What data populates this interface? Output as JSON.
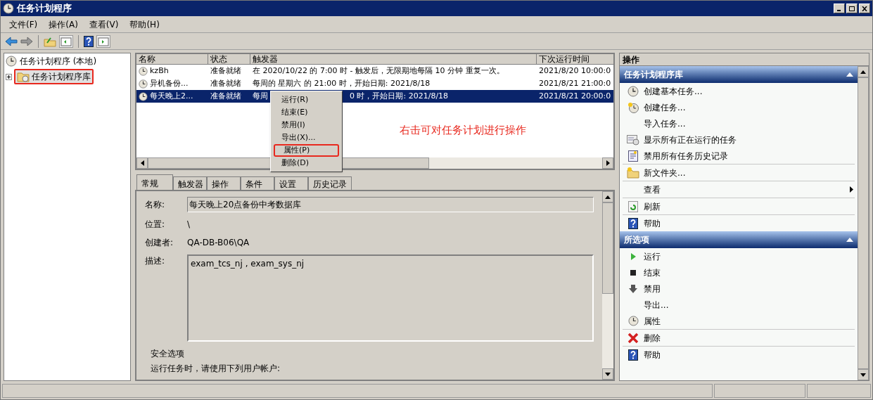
{
  "window": {
    "title": "任务计划程序"
  },
  "menu_bar": [
    "文件(F)",
    "操作(A)",
    "查看(V)",
    "帮助(H)"
  ],
  "tree": {
    "label": "任务计划程序 (本地)",
    "children": [
      {
        "label": "任务计划程序库",
        "selected": true,
        "annotated": true
      }
    ]
  },
  "table": {
    "columns": [
      "名称",
      "状态",
      "触发器",
      "下次运行时间"
    ],
    "rows": [
      {
        "name": "kzBh",
        "status": "准备就绪",
        "trigger": "在 2020/10/22 的 7:00 时 - 触发后，无限期地每隔 10 分钟 重复一次。",
        "next_run": "2021/8/20 10:00:0",
        "selected": false
      },
      {
        "name": "异机备份...",
        "status": "准备就绪",
        "trigger": "每周的 星期六 的 21:00 时，开始日期: 2021/8/18",
        "next_run": "2021/8/21 21:00:0",
        "selected": false
      },
      {
        "name": "每天晚上2...",
        "status": "准备就绪",
        "trigger": "每周",
        "trigger_after_menu": "0 时，开始日期: 2021/8/18",
        "next_run": "2021/8/21 20:00:0",
        "selected": true
      }
    ]
  },
  "context_menu": [
    {
      "label": "运行(R)",
      "annotated": false
    },
    {
      "label": "结束(E)",
      "annotated": false
    },
    {
      "label": "禁用(I)",
      "annotated": false
    },
    {
      "label": "导出(X)...",
      "annotated": false
    },
    {
      "label": "属性(P)",
      "annotated": true
    },
    {
      "label": "删除(D)",
      "annotated": false
    }
  ],
  "annotation": "右击可对任务计划进行操作",
  "tabs": [
    {
      "label": "常规",
      "selected": true
    },
    {
      "label": "触发器",
      "selected": false
    },
    {
      "label": "操作",
      "selected": false
    },
    {
      "label": "条件",
      "selected": false
    },
    {
      "label": "设置",
      "selected": false
    },
    {
      "label": "历史记录",
      "selected": false
    }
  ],
  "general": {
    "name_label": "名称:",
    "name_value": "每天晚上20点备份中考数据库",
    "location_label": "位置:",
    "location_value": "\\",
    "author_label": "创建者:",
    "author_value": "QA-DB-B06\\QA",
    "description_label": "描述:",
    "description_value": "exam_tcs_nj , exam_sys_nj",
    "security_title": "安全选项",
    "run_as_label": "运行任务时，请使用下列用户帐户:"
  },
  "actions_pane": {
    "title": "操作",
    "sections": [
      {
        "title": "任务计划程序库",
        "expanded": true,
        "items": [
          {
            "label": "创建基本任务...",
            "kind": "basic",
            "divider": false,
            "submenu": false
          },
          {
            "label": "创建任务...",
            "kind": "create",
            "divider": false,
            "submenu": false
          },
          {
            "label": "导入任务...",
            "kind": "none",
            "divider": false,
            "submenu": false
          },
          {
            "label": "显示所有正在运行的任务",
            "kind": "running",
            "divider": false,
            "submenu": false
          },
          {
            "label": "禁用所有任务历史记录",
            "kind": "history",
            "divider": false,
            "submenu": false
          },
          {
            "label": "新文件夹...",
            "kind": "folder",
            "divider": true,
            "submenu": false
          },
          {
            "label": "查看",
            "kind": "none",
            "divider": true,
            "submenu": true
          },
          {
            "label": "刷新",
            "kind": "refresh",
            "divider": true,
            "submenu": false
          },
          {
            "label": "帮助",
            "kind": "help",
            "divider": true,
            "submenu": false
          }
        ]
      },
      {
        "title": "所选项",
        "expanded": true,
        "items": [
          {
            "label": "运行",
            "kind": "run",
            "divider": false,
            "submenu": false
          },
          {
            "label": "结束",
            "kind": "stop",
            "divider": false,
            "submenu": false
          },
          {
            "label": "禁用",
            "kind": "disable",
            "divider": false,
            "submenu": false
          },
          {
            "label": "导出...",
            "kind": "none",
            "divider": false,
            "submenu": false
          },
          {
            "label": "属性",
            "kind": "clock",
            "divider": false,
            "submenu": false
          },
          {
            "label": "删除",
            "kind": "delete",
            "divider": true,
            "submenu": false
          },
          {
            "label": "帮助",
            "kind": "help",
            "divider": true,
            "submenu": false
          }
        ]
      }
    ]
  }
}
